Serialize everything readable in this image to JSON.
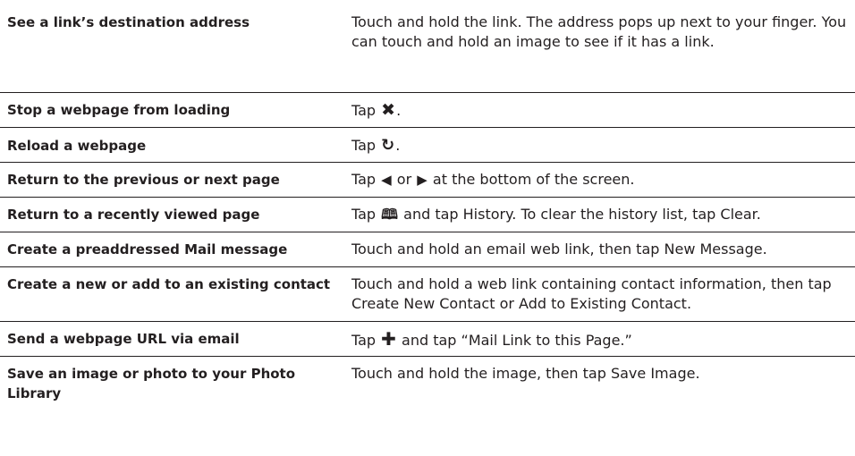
{
  "rows": [
    {
      "action": "See a link’s destination address",
      "howto": "Touch and hold the link. The address pops up next to your finger. You can touch and hold an image to see if it has a link."
    },
    {
      "action": "Stop a webpage from loading",
      "howto_before": "Tap ",
      "howto_icon": "✖",
      "howto_after": "."
    },
    {
      "action": "Reload a webpage",
      "howto_before": "Tap ",
      "howto_icon": "↻",
      "howto_after": "."
    },
    {
      "action": "Return to the previous or next page",
      "howto_before": "Tap ",
      "howto_icon1": "◀",
      "howto_mid": " or ",
      "howto_icon2": "▶",
      "howto_after": " at the bottom of the screen."
    },
    {
      "action": "Return to a recently viewed page",
      "howto_before": "Tap ",
      "howto_icon": "🕮",
      "howto_after": " and tap History. To clear the history list, tap Clear."
    },
    {
      "action": "Create a preaddressed Mail message",
      "howto": "Touch and hold an email web link, then tap New Message."
    },
    {
      "action": "Create a new or add to an existing contact",
      "howto": "Touch and hold a web link containing contact information, then tap Create New Contact or Add to Existing Contact."
    },
    {
      "action": "Send a webpage URL via email",
      "howto_before": "Tap ",
      "howto_icon": "✚",
      "howto_after": " and tap “Mail Link to this Page.”"
    },
    {
      "action": "Save an image or photo to your Photo Library",
      "howto": "Touch and hold the image, then tap Save Image."
    }
  ]
}
